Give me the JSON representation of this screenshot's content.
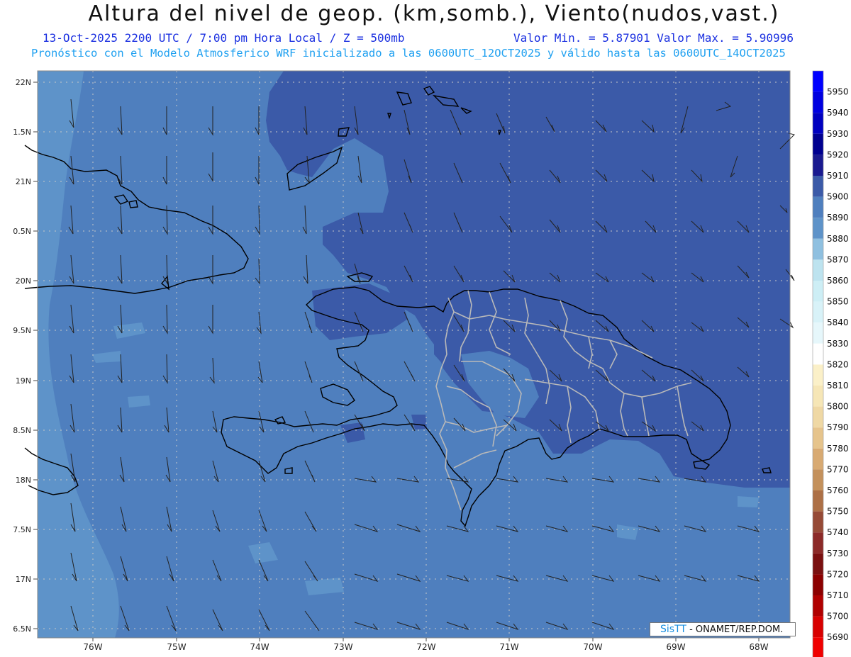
{
  "header": {
    "title": "Altura del nivel de geop. (km,somb.), Viento(nudos,vast.)",
    "datetime": "13-Oct-2025  2200 UTC / 7:00 pm Hora Local / Z = 500mb",
    "minmax": "Valor Min. = 5.87901  Valor Max. = 5.90996",
    "model_info": "Pronóstico con el Modelo Atmosferico WRF inicializado a las 0600UTC_12OCT2025 y válido hasta las  0600UTC_14OCT2025"
  },
  "map": {
    "lat_labels": [
      "22N",
      "1.5N",
      "21N",
      "0.5N",
      "20N",
      "9.5N",
      "19N",
      "8.5N",
      "18N",
      "7.5N",
      "17N",
      "6.5N"
    ],
    "lon_labels": [
      "76W",
      "75W",
      "74W",
      "73W",
      "72W",
      "71W",
      "70W",
      "69W",
      "68W"
    ],
    "colors": {
      "field_low": "#5e93c9",
      "field_mid": "#4f7fbe",
      "field_high": "#3b5aa8",
      "coast": "#000000",
      "provinces": "#b9b9b9",
      "grid": "#c8c8c8"
    }
  },
  "colorbar": {
    "levels": [
      "5950",
      "5940",
      "5930",
      "5920",
      "5910",
      "5900",
      "5890",
      "5880",
      "5870",
      "5860",
      "5850",
      "5840",
      "5830",
      "5820",
      "5810",
      "5800",
      "5790",
      "5780",
      "5770",
      "5760",
      "5750",
      "5740",
      "5730",
      "5720",
      "5710",
      "5700",
      "5690"
    ],
    "colors": [
      "#0000ff",
      "#0000e0",
      "#0000c0",
      "#000090",
      "#1a1a90",
      "#3b5aa8",
      "#4f7fbe",
      "#5e93c9",
      "#8fc0e0",
      "#bde3ef",
      "#cdeef5",
      "#d8f2f8",
      "#e6f7fb",
      "#ffffff",
      "#fbf0c8",
      "#f6e6b6",
      "#efd8a4",
      "#e6c48c",
      "#d8aa72",
      "#c4915c",
      "#ad7046",
      "#964a36",
      "#8c2a28",
      "#7a1010",
      "#8c0000",
      "#b00000",
      "#d80000",
      "#f00000"
    ]
  },
  "footer": {
    "brand": "SisTT",
    "text": "- ONAMET/REP.DOM."
  }
}
